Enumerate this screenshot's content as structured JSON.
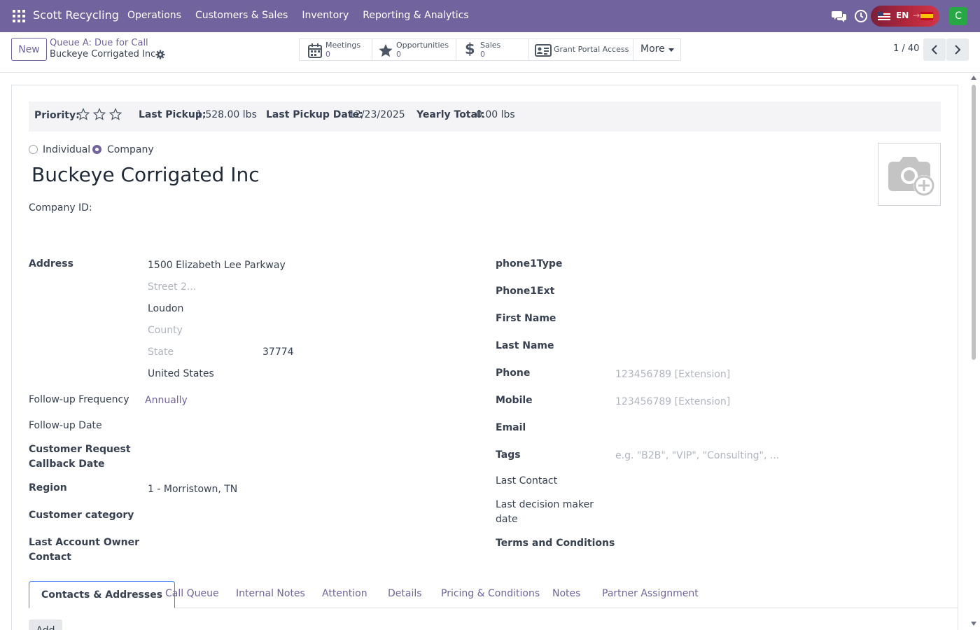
{
  "navbar": {
    "brand": "Scott Recycling",
    "menu": [
      "Operations",
      "Customers & Sales",
      "Inventory",
      "Reporting & Analytics"
    ],
    "lang_from": "EN",
    "lang_arrow": "→",
    "user_initial": "C",
    "accent_color": "#71639e"
  },
  "control": {
    "new_label": "New",
    "breadcrumb_parent": "Queue A: Due for Call",
    "breadcrumb_current": "Buckeye Corrigated Inc",
    "smart_buttons": [
      {
        "label": "Meetings",
        "value": "0",
        "icon": "calendar-icon"
      },
      {
        "label": "Opportunities",
        "value": "0",
        "icon": "star-icon"
      },
      {
        "label": "Sales",
        "value": "0",
        "icon": "dollar-icon"
      },
      {
        "label": "Grant Portal Access",
        "icon": "id-card-icon"
      },
      {
        "label": "More",
        "icon": "caret-down-icon"
      }
    ],
    "pager": "1 / 40"
  },
  "infobar": {
    "priority_label": "Priority:",
    "last_pickup_label": "Last Pickup:",
    "last_pickup_value": "1,528.00 lbs",
    "last_pickup_date_label": "Last Pickup Date:",
    "last_pickup_date_value": "12/23/2025",
    "yearly_total_label": "Yearly Total:",
    "yearly_total_value": "0.00 lbs"
  },
  "form": {
    "type_individual": "Individual",
    "type_company": "Company",
    "selected_type": "Company",
    "company_name": "Buckeye Corrigated Inc",
    "company_id_label": "Company ID:",
    "left": {
      "address_label": "Address",
      "street": "1500 Elizabeth Lee Parkway",
      "street2_placeholder": "Street 2...",
      "city": "Loudon",
      "county_placeholder": "County",
      "state_placeholder": "State",
      "zip": "37774",
      "country": "United States",
      "followup_freq_label": "Follow-up Frequency",
      "followup_freq_value": "Annually",
      "followup_date_label": "Follow-up Date",
      "callback_label_1": "Customer Request",
      "callback_label_2": "Callback Date",
      "region_label": "Region",
      "region_value": "1 - Morristown, TN",
      "category_label": "Customer category",
      "owner_label_1": "Last Account Owner",
      "owner_label_2": "Contact"
    },
    "right": {
      "phone1type_label": "phone1Type",
      "phone1ext_label": "Phone1Ext",
      "first_name_label": "First Name",
      "last_name_label": "Last Name",
      "phone_label": "Phone",
      "phone_placeholder": "123456789 [Extension]",
      "mobile_label": "Mobile",
      "mobile_placeholder": "123456789 [Extension]",
      "email_label": "Email",
      "tags_label": "Tags",
      "tags_placeholder": "e.g. \"B2B\", \"VIP\", \"Consulting\", ...",
      "last_contact_label": "Last Contact",
      "decision_label_1": "Last decision maker",
      "decision_label_2": "date",
      "terms_label": "Terms and Conditions"
    }
  },
  "tabs": [
    "Contacts & Addresses",
    "Call Queue",
    "Internal Notes",
    "Attention",
    "Details",
    "Pricing & Conditions",
    "Notes",
    "Partner Assignment"
  ],
  "active_tab": "Contacts & Addresses",
  "add_label": "Add"
}
